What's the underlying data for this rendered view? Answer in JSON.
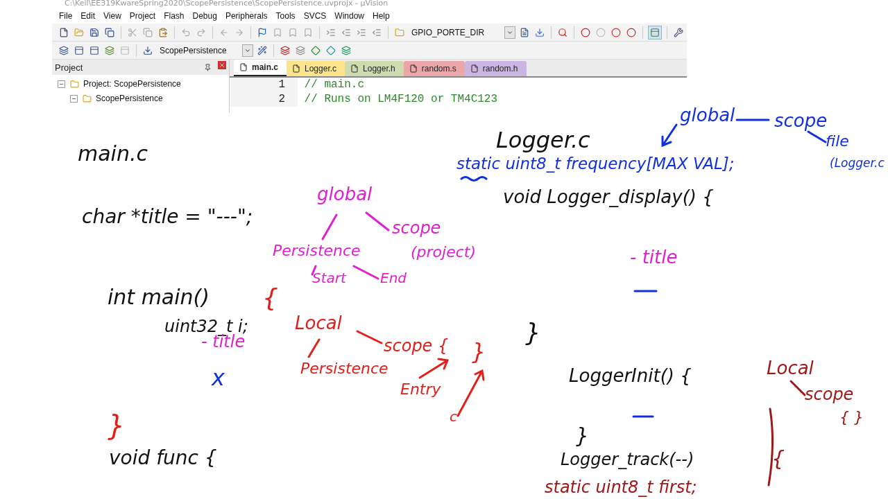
{
  "window": {
    "title": "C:\\Keil\\EE319KwareSpring2020\\ScopePersistence\\ScopePersistence.uvprojx - µVision"
  },
  "menu": [
    "File",
    "Edit",
    "View",
    "Project",
    "Flash",
    "Debug",
    "Peripherals",
    "Tools",
    "SVCS",
    "Window",
    "Help"
  ],
  "toolbar": {
    "find_combo": "GPIO_PORTE_DIR"
  },
  "build_toolbar": {
    "target_combo": "ScopePersistence"
  },
  "project_panel": {
    "title": "Project",
    "tree": [
      {
        "label": "Project: ScopePersistence",
        "expanded": true,
        "children": [
          {
            "label": "ScopePersistence",
            "expanded": true
          }
        ]
      }
    ]
  },
  "tabs": [
    {
      "label": "main.c",
      "selected": true,
      "color": "#ffffff"
    },
    {
      "label": "Logger.c",
      "selected": false,
      "color": "#fce48a"
    },
    {
      "label": "Logger.h",
      "selected": false,
      "color": "#cddcb0"
    },
    {
      "label": "random.s",
      "selected": false,
      "color": "#eba7a7"
    },
    {
      "label": "random.h",
      "selected": false,
      "color": "#cbb5e3"
    }
  ],
  "editor": {
    "lines": [
      {
        "number": "1",
        "text": "// main.c"
      },
      {
        "number": "2",
        "text": "// Runs on LM4F120 or TM4C123"
      }
    ]
  },
  "notes": [
    {
      "text": "main.c",
      "color": "#111111"
    },
    {
      "text": "char *title = \"---\";",
      "color": "#111111"
    },
    {
      "text": "int main()",
      "color": "#111111"
    },
    {
      "text": "{",
      "color": "#e0201a"
    },
    {
      "text": "uint32_t i;",
      "color": "#111111"
    },
    {
      "text": "- title",
      "color": "#e020d0"
    },
    {
      "text": "x",
      "color": "#1030e0"
    },
    {
      "text": "}",
      "color": "#e0201a"
    },
    {
      "text": "void func {",
      "color": "#111111"
    },
    {
      "text": "global",
      "color": "#e020d0"
    },
    {
      "text": "Persistence",
      "color": "#e020d0"
    },
    {
      "text": "scope",
      "color": "#e020d0"
    },
    {
      "text": "(project)",
      "color": "#e020d0"
    },
    {
      "text": "Start",
      "color": "#e020d0"
    },
    {
      "text": "End",
      "color": "#e020d0"
    },
    {
      "text": "Local",
      "color": "#e0201a"
    },
    {
      "text": "scope {",
      "color": "#e0201a"
    },
    {
      "text": "}",
      "color": "#e0201a"
    },
    {
      "text": "Persistence",
      "color": "#e0201a"
    },
    {
      "text": "Entry",
      "color": "#e0201a"
    },
    {
      "text": "c",
      "color": "#e0201a"
    },
    {
      "text": "global",
      "color": "#1030e0"
    },
    {
      "text": "scope",
      "color": "#1030e0"
    },
    {
      "text": "file",
      "color": "#1030e0"
    },
    {
      "text": "(Logger.c",
      "color": "#1030e0"
    },
    {
      "text": "Logger.c",
      "color": "#111111"
    },
    {
      "text": "static uint8_t frequency[MAX VAL];",
      "color": "#1030e0"
    },
    {
      "text": "void Logger_display() {",
      "color": "#111111"
    },
    {
      "text": "- title",
      "color": "#e020d0"
    },
    {
      "text": "}",
      "color": "#111111"
    },
    {
      "text": "Local",
      "color": "#a01818"
    },
    {
      "text": "LoggerInit() {",
      "color": "#111111"
    },
    {
      "text": "scope",
      "color": "#a01818"
    },
    {
      "text": "{ }",
      "color": "#a01818"
    },
    {
      "text": "}",
      "color": "#111111"
    },
    {
      "text": "Logger_track(--)",
      "color": "#111111"
    },
    {
      "text": "{",
      "color": "#a01818"
    },
    {
      "text": "static uint8_t first;",
      "color": "#a01818"
    }
  ]
}
